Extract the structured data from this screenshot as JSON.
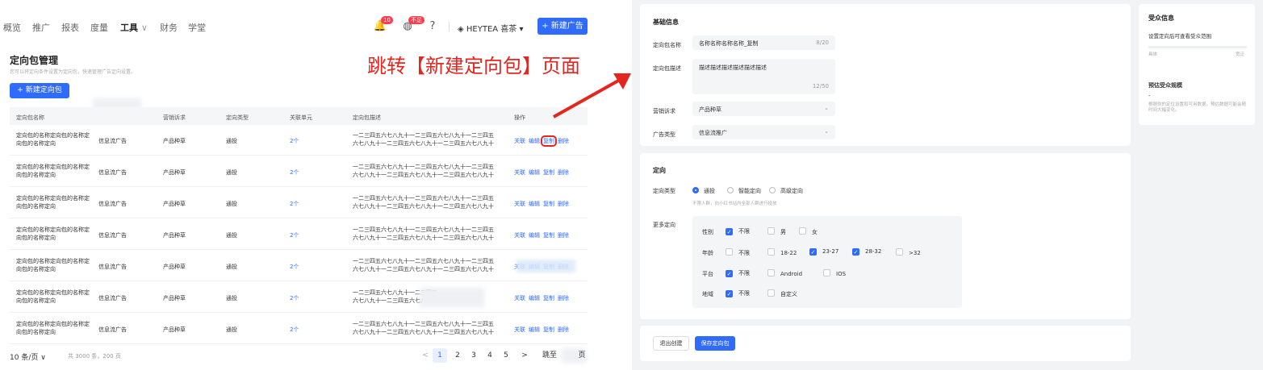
{
  "nav": {
    "items": [
      "概览",
      "推广",
      "报表",
      "度量",
      "工具",
      "财务",
      "学堂"
    ],
    "tools_dropdown": "∨",
    "bell_count": "10",
    "coin_badge": "不足",
    "account": "HEYTEA 喜茶",
    "new_ad": "+ 新建广告"
  },
  "page": {
    "title": "定向包管理",
    "desc": "您可以将定向条件设置为定向包，快速管理广告定向设置。",
    "create": "+ 新建定向包"
  },
  "table": {
    "headers": [
      "定向包名称",
      "营销诉求",
      "定向类型",
      "关联单元",
      "定向包描述",
      "操作"
    ],
    "rows": [
      {
        "name": "定向包的名称定向包的名称定向包的名称定向",
        "ad": "信息流广告",
        "goal": "产品种草",
        "type": "通投",
        "units": "2个",
        "desc1": "一二三四五六七八九十一二三四五六七八九十一二三四五",
        "desc2": "六七八九十一二三四五六七八九十一二三四五六七八九十"
      },
      {
        "name": "定向包的名称定向包的名称定向包的名称定向",
        "ad": "信息流广告",
        "goal": "产品种草",
        "type": "通投",
        "units": "2个",
        "desc1": "一二三四五六七八九十一二三四五六七八九十一二三四五",
        "desc2": "六七八九十一二三四五六七八九十一二三四五六七八九十"
      },
      {
        "name": "定向包的名称定向包的名称定向包的名称定向",
        "ad": "信息流广告",
        "goal": "产品种草",
        "type": "通投",
        "units": "2个",
        "desc1": "一二三四五六七八九十一二三四五六七八九十一二三四五",
        "desc2": "六七八九十一二三四五六七八九十一二三四五六七八九十"
      },
      {
        "name": "定向包的名称定向包的名称定向包的名称定向",
        "ad": "信息流广告",
        "goal": "产品种草",
        "type": "通投",
        "units": "2个",
        "desc1": "一二三四五六七八九十一二三四五六七八九十一二三四五",
        "desc2": "六七八九十一二三四五六七八九十一二三四五六七八九十"
      },
      {
        "name": "定向包的名称定向包的名称定向包的名称定向",
        "ad": "信息流广告",
        "goal": "产品种草",
        "type": "通投",
        "units": "2个",
        "desc1": "一二三四五六七八九十一二三四五六七八九十一二三四五",
        "desc2": "六七八九十一二三四五六七八九十一二三四五六七八九十"
      },
      {
        "name": "定向包的名称定向包的名称定向包的名称定向",
        "ad": "信息流广告",
        "goal": "产品种草",
        "type": "通投",
        "units": "2个",
        "desc1": "一二三四五六七八九十一二三四五",
        "desc2": "六七八九十一二三四五六七八九十"
      },
      {
        "name": "定向包的名称定向包的名称定向包的名称定向",
        "ad": "信息流广告",
        "goal": "产品种草",
        "type": "通投",
        "units": "2个",
        "desc1": "一二三四五六七八九十一二三四五六七八九十一二三四五",
        "desc2": "六七八九十一二三四五六七八九十一二三四五六七八九十"
      }
    ],
    "ops": [
      "关联",
      "编辑",
      "复制",
      "删除"
    ]
  },
  "pager": {
    "size": "10 条/页 ∨",
    "total": "共 3000 条，200 页",
    "prev": "<",
    "pages": [
      "1",
      "2",
      "3",
      "4",
      "5"
    ],
    "next": ">",
    "jump": "跳至",
    "jump_suffix": "页"
  },
  "annotation": "跳转【新建定向包】页面",
  "form": {
    "basic_title": "基础信息",
    "name_label": "定向包名称",
    "name_value": "名称名称名称名称_复制",
    "name_count": "8/20",
    "desc_label": "定向包描述",
    "desc_value": "描述描述描述描述描述描述",
    "desc_count": "12/50",
    "goal_label": "营销诉求",
    "goal_value": "产品种草",
    "adtype_label": "广告类型",
    "adtype_value": "信息流推广",
    "targeting_title": "定向",
    "type_label": "定向类型",
    "type_options": [
      "通投",
      "智能定向",
      "高级定向"
    ],
    "type_hint": "不限人群，向小红书站内全部人群进行投放",
    "more_label": "更多定向",
    "gender_label": "性别",
    "gender_options": [
      "不限",
      "男",
      "女"
    ],
    "age_label": "年龄",
    "age_options": [
      "不限",
      "18-22",
      "23-27",
      "28-32",
      ">32"
    ],
    "platform_label": "平台",
    "platform_options": [
      "不限",
      "Android",
      "IOS"
    ],
    "region_label": "地域",
    "region_options": [
      "不限",
      "自定义"
    ],
    "exit": "退出创建",
    "save": "保存定向包"
  },
  "audience": {
    "title": "受众信息",
    "subtitle": "设置定向后可查看受众范围",
    "left_tag": "具体",
    "right_tag": "宽泛",
    "est_title": "预估受众规模",
    "est_value": "-",
    "est_hint": "根据你的定位设置和可用数据，预估数据可能会随时间大幅变化。"
  },
  "colors": {
    "primary": "#2f6bff",
    "annotation": "#e5261f",
    "right_bg": "#f2f3f5"
  }
}
